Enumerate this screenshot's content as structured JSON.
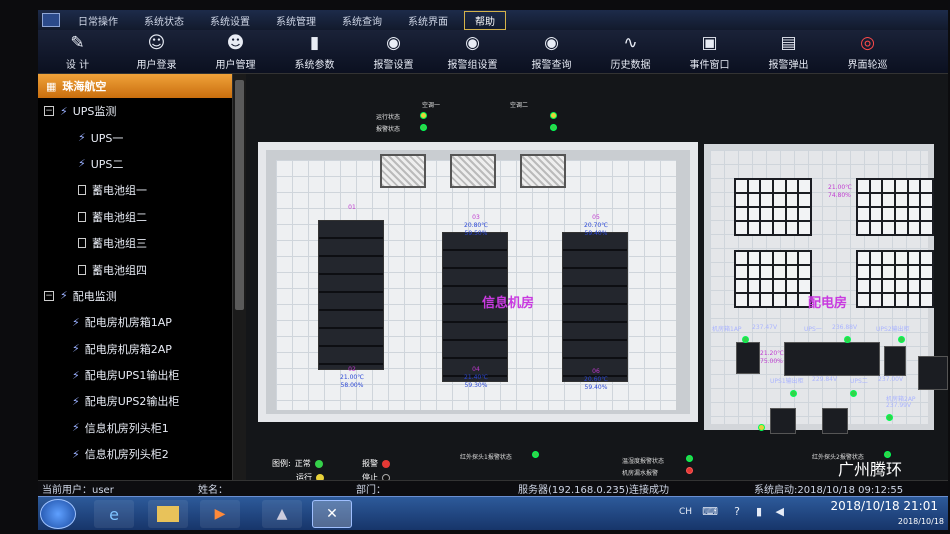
{
  "menubar": {
    "items": [
      "日常操作",
      "系统状态",
      "系统设置",
      "系统管理",
      "系统查询",
      "系统界面",
      "帮助"
    ]
  },
  "toolbar": {
    "buttons": [
      {
        "label": "设 计",
        "icon": "design-icon"
      },
      {
        "label": "用户登录",
        "icon": "user-login-icon"
      },
      {
        "label": "用户管理",
        "icon": "user-manage-icon"
      },
      {
        "label": "系统参数",
        "icon": "params-icon"
      },
      {
        "label": "报警设置",
        "icon": "alarm-settings-icon"
      },
      {
        "label": "报警组设置",
        "icon": "alarm-group-icon"
      },
      {
        "label": "报警查询",
        "icon": "alarm-query-icon"
      },
      {
        "label": "历史数据",
        "icon": "history-icon"
      },
      {
        "label": "事件窗口",
        "icon": "event-window-icon"
      },
      {
        "label": "报警弹出",
        "icon": "alarm-popup-icon"
      },
      {
        "label": "界面轮巡",
        "icon": "patrol-icon"
      }
    ]
  },
  "sidebar": {
    "root": "珠海航空",
    "items": [
      {
        "label": "UPS监测",
        "type": "group"
      },
      {
        "label": "UPS一",
        "type": "leaf"
      },
      {
        "label": "UPS二",
        "type": "leaf"
      },
      {
        "label": "蓄电池组一",
        "type": "battery"
      },
      {
        "label": "蓄电池组二",
        "type": "battery"
      },
      {
        "label": "蓄电池组三",
        "type": "battery"
      },
      {
        "label": "蓄电池组四",
        "type": "battery"
      },
      {
        "label": "配电监测",
        "type": "group"
      },
      {
        "label": "配电房机房箱1AP",
        "type": "leaf2"
      },
      {
        "label": "配电房机房箱2AP",
        "type": "leaf2"
      },
      {
        "label": "配电房UPS1输出柜",
        "type": "leaf2"
      },
      {
        "label": "配电房UPS2输出柜",
        "type": "leaf2"
      },
      {
        "label": "信息机房列头柜1",
        "type": "leaf2"
      },
      {
        "label": "信息机房列头柜2",
        "type": "leaf2"
      }
    ]
  },
  "main": {
    "top_labels": [
      "空调一",
      "空调二",
      "运行状态",
      "报警状态"
    ],
    "room1_title": "信息机房",
    "room2_title": "配电房",
    "racks": [
      {
        "id": "01",
        "temp": "",
        "hum": ""
      },
      {
        "id": "03",
        "temp": "20.80℃",
        "hum": "59.50%"
      },
      {
        "id": "05",
        "temp": "20.70℃",
        "hum": "59.40%"
      },
      {
        "id": "02",
        "temp": "21.00℃",
        "hum": "58.00%"
      },
      {
        "id": "04",
        "temp": "21.40℃",
        "hum": "59.30%"
      },
      {
        "id": "06",
        "temp": "20.60℃",
        "hum": "59.40%"
      }
    ],
    "elec_labels": {
      "top_temp": "21.00℃",
      "top_hum": "74.80%",
      "b1ap": "机房箱1AP",
      "b1ap_v": "237.47V",
      "ups1": "UPS一",
      "ups1_v": "236.88V",
      "ups2out": "UPS2输出柜",
      "mid_temp": "21.20℃",
      "mid_hum": "75.00%",
      "ups1out": "UPS1输出柜",
      "ups1out_v": "229.84V",
      "ups2": "UPS二",
      "ups2_v": "237.00V",
      "b2ap": "机房箱2AP",
      "b2ap_v": "237.99V"
    },
    "legend": {
      "normal": "正常",
      "alarm": "报警",
      "run": "运行",
      "stop": "停止",
      "title": "图例:"
    },
    "bottom_labels": [
      "红外探头1报警状态",
      "温湿度报警状态",
      "机房漏水报警",
      "红外探头2报警状态"
    ]
  },
  "status": {
    "user": "当前用户：user",
    "name": "姓名：",
    "dept": "部门：",
    "server": "服务器(192.168.0.235)连接成功",
    "start": "系统启动:2018/10/18 09:12:55"
  },
  "taskbar": {
    "clock": "2018/10/18  21:01",
    "date": "2018/10/18",
    "ime": "CH"
  },
  "watermark": "广州腾环",
  "colors": {
    "accent": "#d48a1f",
    "ok": "#35d04a",
    "alarm": "#e53935",
    "run": "#e8d13a",
    "label": "#c93ae0"
  }
}
